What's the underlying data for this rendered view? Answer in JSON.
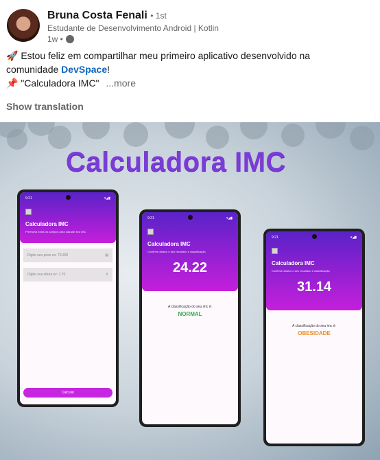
{
  "post": {
    "author": "Bruna Costa Fenali",
    "degree": "• 1st",
    "headline": "Estudante de Desenvolvimento Android | Kotlin",
    "time": "1w •",
    "line1": "🚀 Estou feliz em compartilhar meu primeiro aplicativo desenvolvido na",
    "line2_pre": "comunidade ",
    "line2_link": "DevSpace",
    "line2_post": "!",
    "line3": "📌 \"Calculadora IMC\"",
    "more": "...more",
    "show_translation": "Show translation"
  },
  "image": {
    "title": "Calculadora IMC",
    "status_time": "9:21",
    "app_title": "Calculadora IMC",
    "input_screen": {
      "subtitle": "Preencha todos os campos para calcular seu IMC",
      "weight_placeholder": "Digite seu peso ex: 70.200",
      "height_placeholder": "Digite sua altura ex: 1.70",
      "button": "Calcular"
    },
    "result_subtitle": "Confirme abaixo o seu resultado e classificação",
    "classification_label": "A classificação do seu imc é:",
    "results": [
      {
        "value": "24.22",
        "class": "NORMAL",
        "color": "#3aa655"
      },
      {
        "value": "31.14",
        "class": "OBESIDADE",
        "color": "#f08a1c"
      }
    ]
  }
}
